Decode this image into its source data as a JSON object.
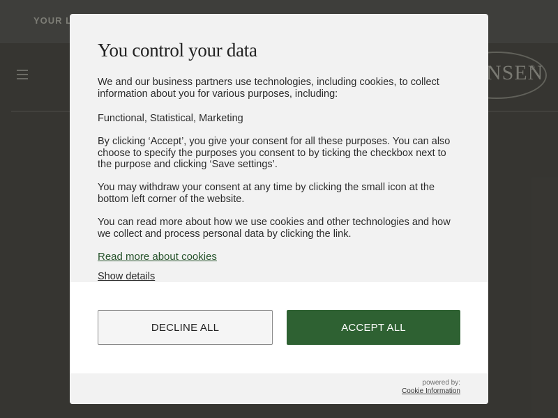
{
  "site": {
    "topbar_text": "YOUR LO",
    "brand_text": "NSEN",
    "brand_reg": "®"
  },
  "consent": {
    "title": "You control your data",
    "paragraphs": [
      "We and our business partners use technologies, including cookies, to collect information about you for various purposes, including:",
      "Functional, Statistical, Marketing",
      "By clicking ‘Accept’, you give your consent for all these purposes. You can also choose to specify the purposes you consent to by ticking the checkbox next to the purpose and clicking ‘Save settings’.",
      "You may withdraw your consent at any time by clicking the small icon at the bottom left corner of the website.",
      "You can read more about how we use cookies and other technologies and how we collect and process personal data by clicking the link."
    ],
    "read_more_label": "Read more about cookies",
    "show_details_label": "Show details",
    "decline_label": "DECLINE ALL",
    "accept_label": "ACCEPT ALL",
    "powered_by": "powered by:",
    "provider_label": "Cookie Information"
  },
  "colors": {
    "accent_green": "#2e6132",
    "link_green": "#26532b",
    "dialog_bg": "#f2f2f2",
    "backdrop": "#3b3a36"
  },
  "icons": {
    "menu": "hamburger-menu-icon"
  }
}
